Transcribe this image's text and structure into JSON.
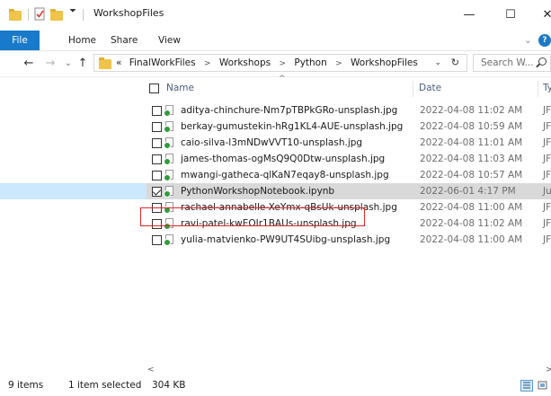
{
  "window": {
    "title": "WorkshopFiles",
    "controls": {
      "minimize": "—",
      "maximize": "☐",
      "close": "✕"
    }
  },
  "ribbon": {
    "tabs": [
      "File",
      "Home",
      "Share",
      "View"
    ],
    "expand": "⌄",
    "help": "?"
  },
  "address": {
    "prefix": "«",
    "crumbs": [
      "FinalWorkFiles",
      "Workshops",
      "Python",
      "WorkshopFiles"
    ],
    "search_placeholder": "Search W..."
  },
  "nav": {
    "back": "←",
    "forward": "→",
    "recent": "⌄",
    "up": "↑"
  },
  "columns": {
    "name": "Name",
    "date": "Date",
    "type": "Ty"
  },
  "files": [
    {
      "name": "aditya-chinchure-Nm7pTBPkGRo-unsplash.jpg",
      "date": "2022-04-08 11:02 AM",
      "type": "JF",
      "selected": false
    },
    {
      "name": "berkay-gumustekin-hRg1KL4-AUE-unsplash.jpg",
      "date": "2022-04-08 10:59 AM",
      "type": "JF",
      "selected": false
    },
    {
      "name": "caio-silva-l3mNDwVVT10-unsplash.jpg",
      "date": "2022-04-08 11:01 AM",
      "type": "JF",
      "selected": false
    },
    {
      "name": "james-thomas-ogMsQ9Q0Dtw-unsplash.jpg",
      "date": "2022-04-08 11:03 AM",
      "type": "JF",
      "selected": false
    },
    {
      "name": "mwangi-gatheca-qlKaN7eqay8-unsplash.jpg",
      "date": "2022-04-08 10:57 AM",
      "type": "JF",
      "selected": false
    },
    {
      "name": "PythonWorkshopNotebook.ipynb",
      "date": "2022-06-01 4:17 PM",
      "type": "Ju",
      "selected": true
    },
    {
      "name": "rachael-annabelle-XeYmx-qBsUk-unsplash.jpg",
      "date": "2022-04-08 11:00 AM",
      "type": "JF",
      "selected": false
    },
    {
      "name": "ravi-patel-kwEOIr1BAUs-unsplash.jpg",
      "date": "2022-04-08 11:02 AM",
      "type": "JF",
      "selected": false
    },
    {
      "name": "yulia-matvienko-PW9UT4SUibg-unsplash.jpg",
      "date": "2022-04-08 11:00 AM",
      "type": "JF",
      "selected": false
    }
  ],
  "scroll": {
    "left": "<",
    "right": ">"
  },
  "status": {
    "items": "9 items",
    "selected": "1 item selected",
    "size": "304 KB"
  }
}
